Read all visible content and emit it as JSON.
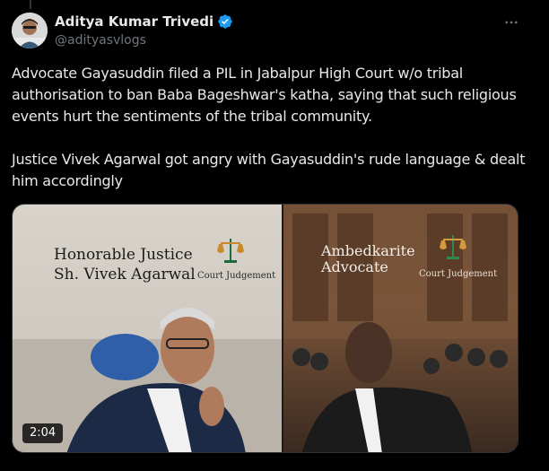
{
  "author": {
    "display_name": "Aditya Kumar Trivedi",
    "handle": "@adityasvlogs",
    "verified": true
  },
  "tweet": {
    "text": "Advocate Gayasuddin filed a PIL in Jabalpur High Court w/o tribal authorisation to ban Baba Bageshwar's katha, saying that such religious events hurt the sentiments of the tribal community.\n\nJustice Vivek Agarwal got angry with Gayasuddin's rude language & dealt him accordingly"
  },
  "media": {
    "judge_caption_line1": "Honorable Justice",
    "judge_caption_line2": "Sh. Vivek Agarwal",
    "advocate_caption_line1": "Ambedkarite",
    "advocate_caption_line2": "Advocate",
    "court_label_left": "Court Judgement",
    "court_label_right": "Court Judgement",
    "duration": "2:04"
  },
  "icons": {
    "verified": "verified-badge-icon",
    "more": "more-options-icon",
    "scale": "scales-of-justice-icon"
  },
  "colors": {
    "background": "#000000",
    "text_primary": "#e7e9ea",
    "text_secondary": "#71767b",
    "verified_blue": "#1d9bf0"
  }
}
